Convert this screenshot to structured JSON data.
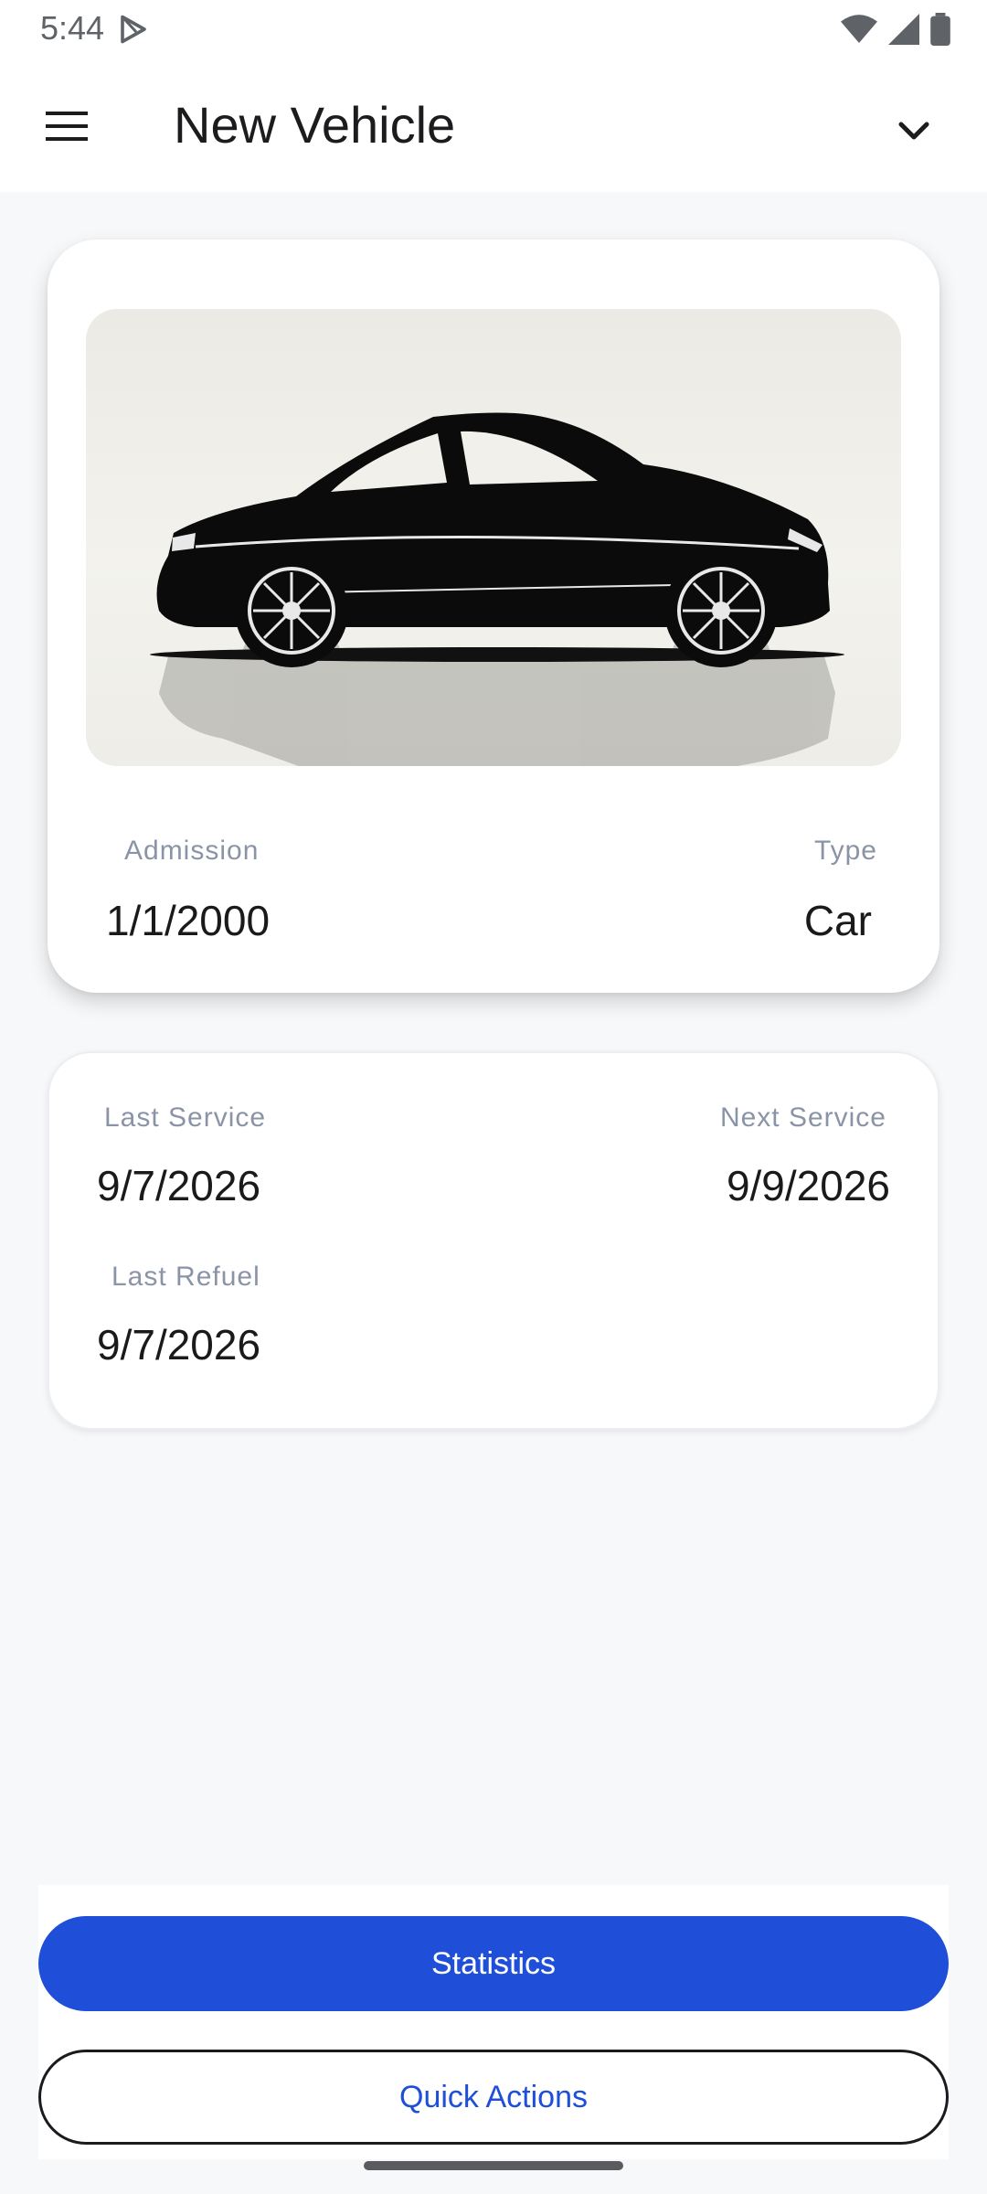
{
  "status_bar": {
    "time": "5:44",
    "icons": [
      "play-store-icon",
      "wifi-icon",
      "cell-signal-icon",
      "battery-icon"
    ]
  },
  "app_bar": {
    "title": "New Vehicle",
    "menu_icon": "hamburger-menu-icon",
    "dropdown_icon": "chevron-down-icon"
  },
  "vehicle_card": {
    "image_icon": "sedan-car-illustration",
    "admission_label": "Admission",
    "admission_value": "1/1/2000",
    "type_label": "Type",
    "type_value": "Car"
  },
  "service_card": {
    "last_service_label": "Last Service",
    "last_service_value": "9/7/2026",
    "next_service_label": "Next Service",
    "next_service_value": "9/9/2026",
    "last_refuel_label": "Last Refuel",
    "last_refuel_value": "9/7/2026"
  },
  "actions": {
    "statistics_label": "Statistics",
    "quick_actions_label": "Quick Actions"
  },
  "colors": {
    "accent": "#1f4fd8",
    "background": "#f7f8fa",
    "label": "#8a94a6"
  }
}
